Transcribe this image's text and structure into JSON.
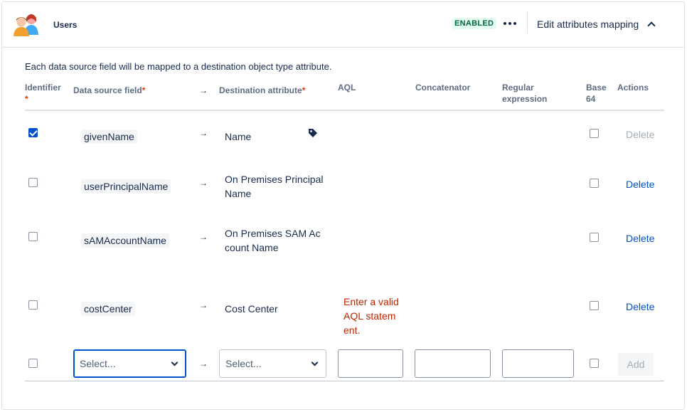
{
  "header": {
    "title": "Users",
    "status_badge": "ENABLED",
    "more_icon": "more-horizontal-icon",
    "edit_mapping_label": "Edit attributes mapping",
    "collapse_icon": "chevron-up-icon"
  },
  "description": "Each data source field will be mapped to a destination object type attribute.",
  "columns": {
    "identifier": "Identifier",
    "data_source_field": "Data source field",
    "destination_attribute": "Destination attribute",
    "aql": "AQL",
    "concatenator": "Concatenator",
    "regular_expression": "Regular expression",
    "base64": "Base 64",
    "actions": "Actions",
    "required_marker": "*",
    "arrow": "→"
  },
  "rows": [
    {
      "identifier_checked": true,
      "source": "givenName",
      "destination": "Name",
      "destination_icon": "tag-icon",
      "aql_error": "",
      "base64_checked": false,
      "action": "Delete",
      "action_disabled": true
    },
    {
      "identifier_checked": false,
      "source": "userPrincipalName",
      "destination": "On Premises Principal Name",
      "aql_error": "",
      "base64_checked": false,
      "action": "Delete",
      "action_disabled": false
    },
    {
      "identifier_checked": false,
      "source": "sAMAccountName",
      "destination": "On Premises SAM Account Name",
      "aql_error": "",
      "base64_checked": false,
      "action": "Delete",
      "action_disabled": false
    },
    {
      "identifier_checked": false,
      "source": "costCenter",
      "destination": "Cost Center",
      "aql_error": "Enter a valid AQL statement.",
      "base64_checked": false,
      "action": "Delete",
      "action_disabled": false
    }
  ],
  "new_row": {
    "source_placeholder": "Select...",
    "destination_placeholder": "Select...",
    "aql_value": "",
    "concatenator_value": "",
    "regex_value": "",
    "add_label": "Add"
  },
  "colors": {
    "primary": "#0052cc",
    "success_bg": "#e3fcef",
    "success_text": "#006644",
    "error": "#bf2600",
    "required": "#de350b"
  }
}
